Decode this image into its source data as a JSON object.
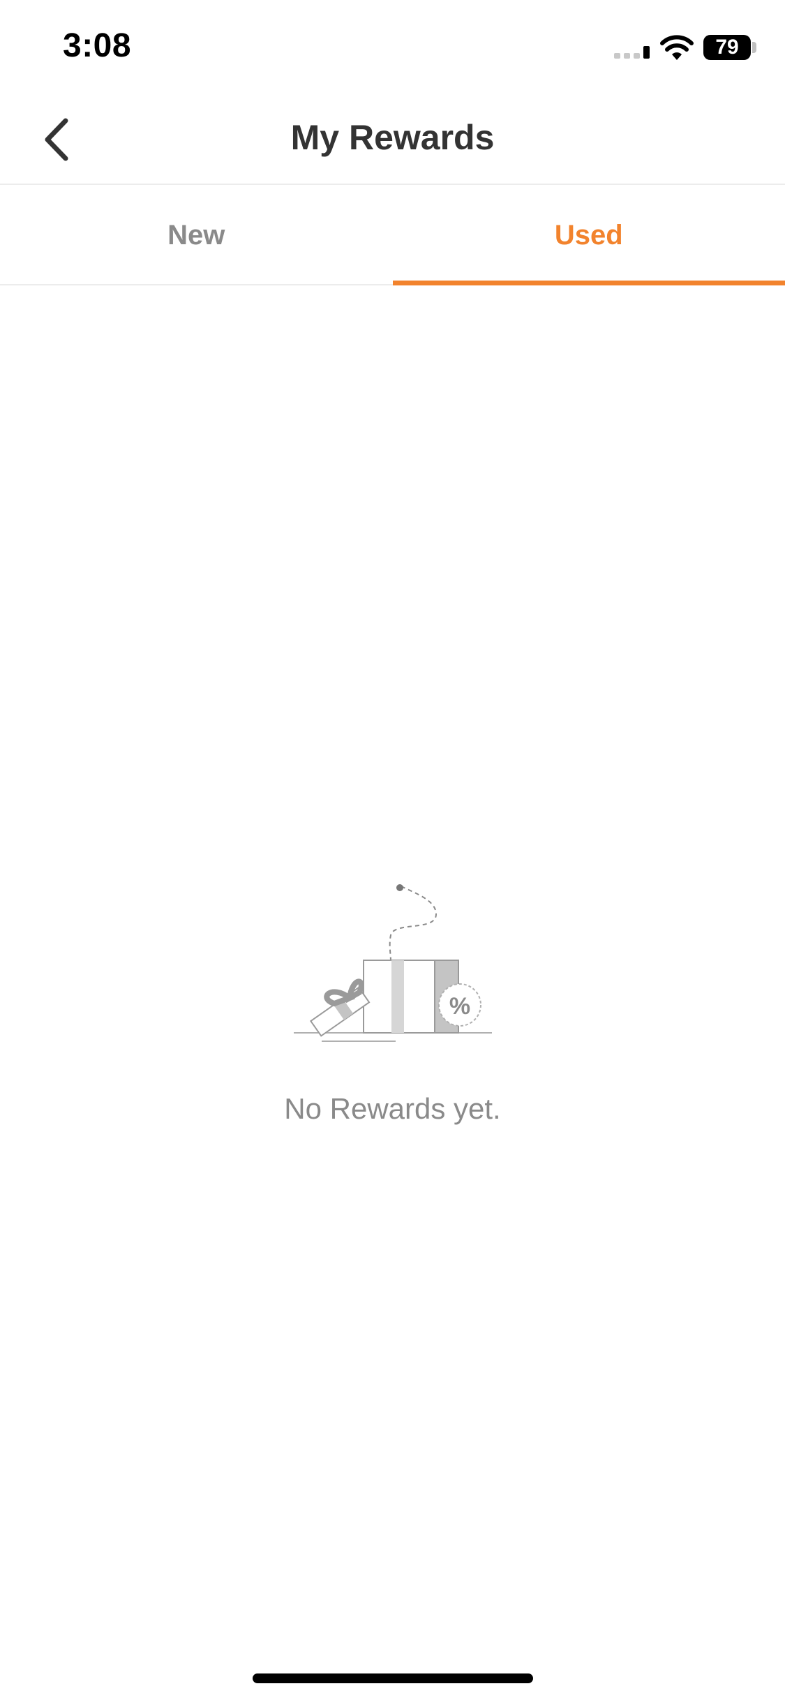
{
  "status_bar": {
    "time": "3:08",
    "battery_level": "79",
    "icons": [
      "cellular-signal-icon",
      "wifi-icon",
      "battery-icon"
    ]
  },
  "header": {
    "title": "My Rewards",
    "back_icon": "chevron-left-icon"
  },
  "tabs": [
    {
      "label": "New",
      "active": false
    },
    {
      "label": "Used",
      "active": true
    }
  ],
  "empty_state": {
    "illustration": "open-gift-box-icon",
    "badge_symbol": "%",
    "message": "No Rewards yet."
  },
  "colors": {
    "accent": "#f2832d",
    "title_text": "#333333",
    "muted_text": "#8a8a8a",
    "divider": "#ececec"
  }
}
